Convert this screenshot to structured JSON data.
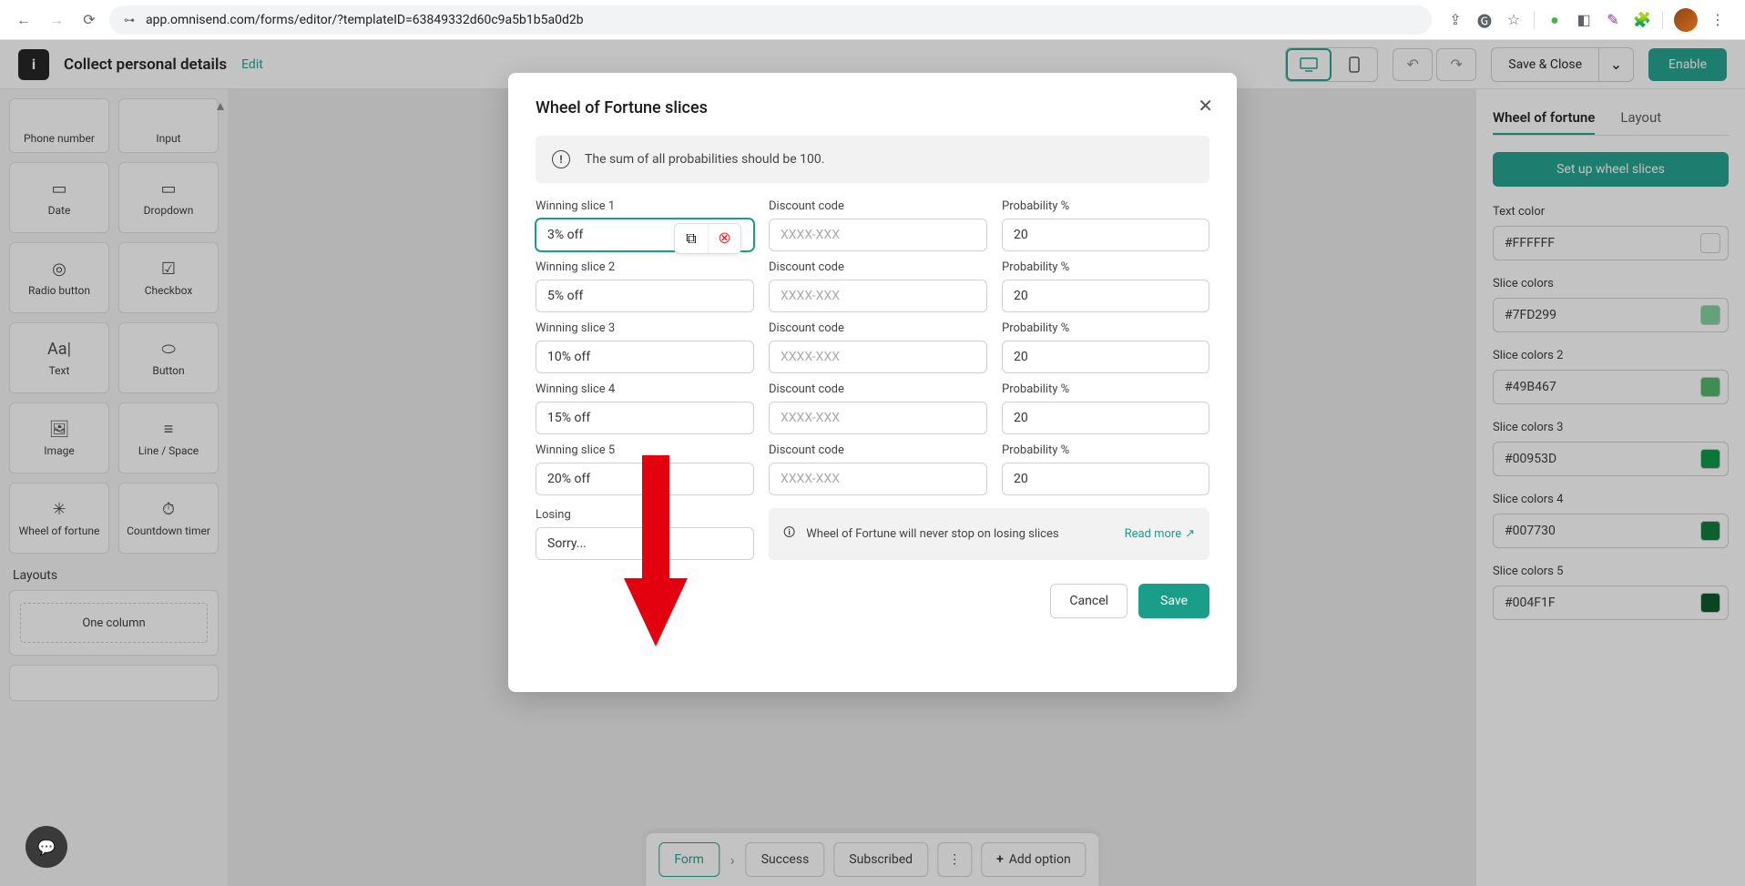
{
  "browser": {
    "url": "app.omnisend.com/forms/editor/?templateID=63849332d60c9a5b1b5a0d2b"
  },
  "header": {
    "title": "Collect personal details",
    "edit": "Edit",
    "save_close": "Save & Close",
    "enable": "Enable"
  },
  "sidebar": {
    "widgets": [
      {
        "label": "Phone number"
      },
      {
        "label": "Input"
      },
      {
        "label": "Date"
      },
      {
        "label": "Dropdown"
      },
      {
        "label": "Radio button"
      },
      {
        "label": "Checkbox"
      },
      {
        "label": "Text"
      },
      {
        "label": "Button"
      },
      {
        "label": "Image"
      },
      {
        "label": "Line / Space"
      },
      {
        "label": "Wheel of fortune"
      },
      {
        "label": "Countdown timer"
      }
    ],
    "layouts_label": "Layouts",
    "layout_one": "One column"
  },
  "right": {
    "tabs": {
      "wof": "Wheel of fortune",
      "layout": "Layout"
    },
    "setup": "Set up wheel slices",
    "text_color_label": "Text color",
    "text_color": "#FFFFFF",
    "slice_colors": [
      {
        "label": "Slice colors",
        "value": "#7FD299"
      },
      {
        "label": "Slice colors 2",
        "value": "#49B467"
      },
      {
        "label": "Slice colors 3",
        "value": "#00953D"
      },
      {
        "label": "Slice colors 4",
        "value": "#007730"
      },
      {
        "label": "Slice colors 5",
        "value": "#004F1F"
      }
    ]
  },
  "bottom": {
    "form": "Form",
    "success": "Success",
    "subscribed": "Subscribed",
    "add": "Add option"
  },
  "modal": {
    "title": "Wheel of Fortune slices",
    "info": "The sum of all probabilities should be 100.",
    "col_discount": "Discount code",
    "col_prob": "Probability %",
    "discount_placeholder": "XXXX-XXX",
    "slices": [
      {
        "label": "Winning slice 1",
        "value": "3% off",
        "prob": "20"
      },
      {
        "label": "Winning slice 2",
        "value": "5% off",
        "prob": "20"
      },
      {
        "label": "Winning slice 3",
        "value": "10% off",
        "prob": "20"
      },
      {
        "label": "Winning slice 4",
        "value": "15% off",
        "prob": "20"
      },
      {
        "label": "Winning slice 5",
        "value": "20% off",
        "prob": "20"
      }
    ],
    "losing_label": "Losing",
    "losing_value": "Sorry...",
    "losing_info": "Wheel of Fortune will never stop on losing slices",
    "read_more": "Read more",
    "cancel": "Cancel",
    "save": "Save"
  }
}
